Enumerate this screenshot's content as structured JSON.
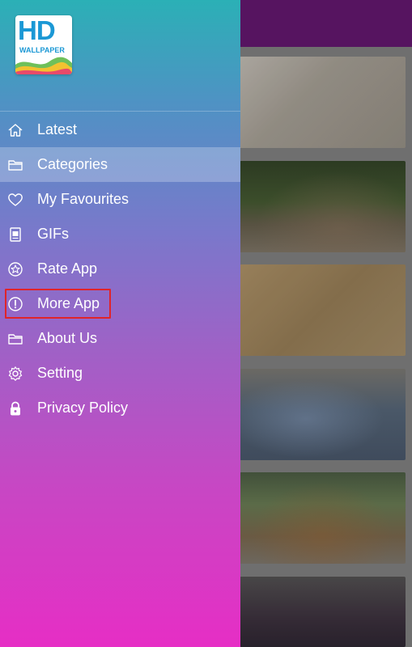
{
  "app": {
    "header_color": "#561460"
  },
  "drawer": {
    "logo": {
      "big_text": "HD",
      "small_text": "WALLPAPER"
    },
    "menu": [
      {
        "label": "Latest",
        "icon": "home-icon",
        "selected": false
      },
      {
        "label": "Categories",
        "icon": "folder-icon",
        "selected": true
      },
      {
        "label": "My Favourites",
        "icon": "heart-icon",
        "selected": false
      },
      {
        "label": "GIFs",
        "icon": "image-file-icon",
        "selected": false
      },
      {
        "label": "Rate App",
        "icon": "rate-icon",
        "selected": false
      },
      {
        "label": "More App",
        "icon": "info-circle-icon",
        "selected": false,
        "highlighted": true
      },
      {
        "label": "About Us",
        "icon": "folder-icon",
        "selected": false
      },
      {
        "label": "Setting",
        "icon": "gear-icon",
        "selected": false
      },
      {
        "label": "Privacy Policy",
        "icon": "lock-icon",
        "selected": false
      }
    ]
  },
  "colors": {
    "drawer_top": "#2bb0b6",
    "drawer_bottom": "#e62ec5",
    "highlight_border": "#e0242a",
    "text": "#ffffff"
  }
}
